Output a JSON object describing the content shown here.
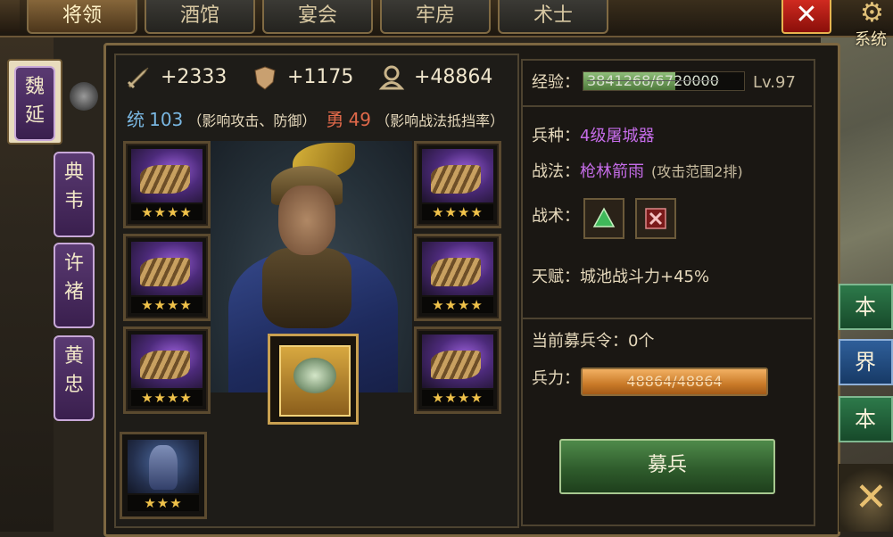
{
  "tabs": [
    {
      "label": "将领",
      "active": true
    },
    {
      "label": "酒馆",
      "active": false
    },
    {
      "label": "宴会",
      "active": false
    },
    {
      "label": "牢房",
      "active": false
    },
    {
      "label": "术士",
      "active": false
    }
  ],
  "system_label": "系统",
  "generals": [
    {
      "name_top": "魏",
      "name_bottom": "延",
      "selected": true
    },
    {
      "name_top": "典",
      "name_bottom": "韦",
      "selected": false
    },
    {
      "name_top": "许",
      "name_bottom": "褚",
      "selected": false
    },
    {
      "name_top": "黄",
      "name_bottom": "忠",
      "selected": false
    }
  ],
  "stats": {
    "attack": "+2333",
    "defense": "+1175",
    "troops": "+48864"
  },
  "attributes": {
    "tong_label": "统",
    "tong_value": "103",
    "tong_desc": "（影响攻击、防御）",
    "yong_label": "勇",
    "yong_value": "49",
    "yong_desc": "（影响战法抵挡率）"
  },
  "equipment_stars": "★★★★",
  "extra_stars": "★★★",
  "right": {
    "exp_label": "经验：",
    "exp_value": "3841268/6720000",
    "exp_fraction": 0.5716,
    "level": "Lv.97",
    "unit_label": "兵种：",
    "unit_value": "4级屠城器",
    "tactic_label": "战法：",
    "tactic_value": "枪林箭雨",
    "tactic_note": "(攻击范围2排)",
    "skill_label": "战术：",
    "talent_label": "天赋：",
    "talent_value": "城池战斗力+45%",
    "token_label": "当前募兵令：",
    "token_value": "0个",
    "troops_label": "兵力：",
    "troops_value": "48864/48864",
    "troops_fraction": 1.0,
    "recruit_button": "募兵"
  },
  "side_buttons": [
    "本",
    "界",
    "本"
  ],
  "colors": {
    "accent_purple": "#c56ce8",
    "tong_blue": "#79b6e0",
    "yong_red": "#e0694a",
    "troop_orange": "#c97a28",
    "recruit_green": "#2f5c2c"
  }
}
